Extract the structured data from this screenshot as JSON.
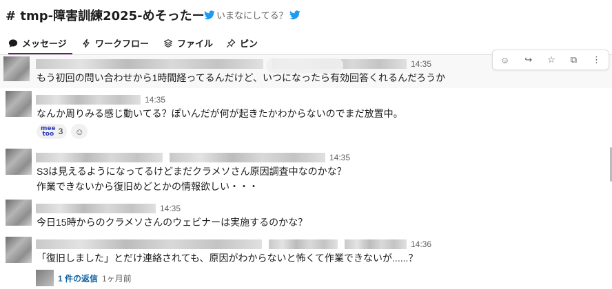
{
  "channel": {
    "title": "# tmp-障害訓練2025-めそったー",
    "topic": "いまなにしてる？"
  },
  "tabs": [
    {
      "label": "メッセージ"
    },
    {
      "label": "ワークフロー"
    },
    {
      "label": "ファイル"
    },
    {
      "label": "ピン"
    }
  ],
  "messages": [
    {
      "time": "14:35",
      "text": "もう初回の問い合わせから1時間経ってるんだけど、いつになったら有効回答くれるんだろうか"
    },
    {
      "time": "14:35",
      "text": "なんか周りみる感じ動いてる？ぽいんだが何が起きたかわからないのでまだ放置中。",
      "reaction_count": "3",
      "reaction_name": "meetoo"
    },
    {
      "time": "14:35",
      "text": "S3は見えるようになってるけどまだクラメソさん原因調査中なのかな？",
      "text2": "作業できないから復旧めどとかの情報欲しい・・・"
    },
    {
      "time": "14:35",
      "text": "今日15時からのクラメソさんのウェビナーは実施するのかな？"
    },
    {
      "time": "14:36",
      "text": "「復旧しました」とだけ連絡されても、原因がわからないと怖くて作業できないが......？",
      "reply_count": "1 件の返信",
      "reply_ago": "1ヶ月前"
    }
  ],
  "colors": {
    "accent": "#611f69",
    "link": "#1264a3",
    "twitter": "#1d9bf0"
  }
}
